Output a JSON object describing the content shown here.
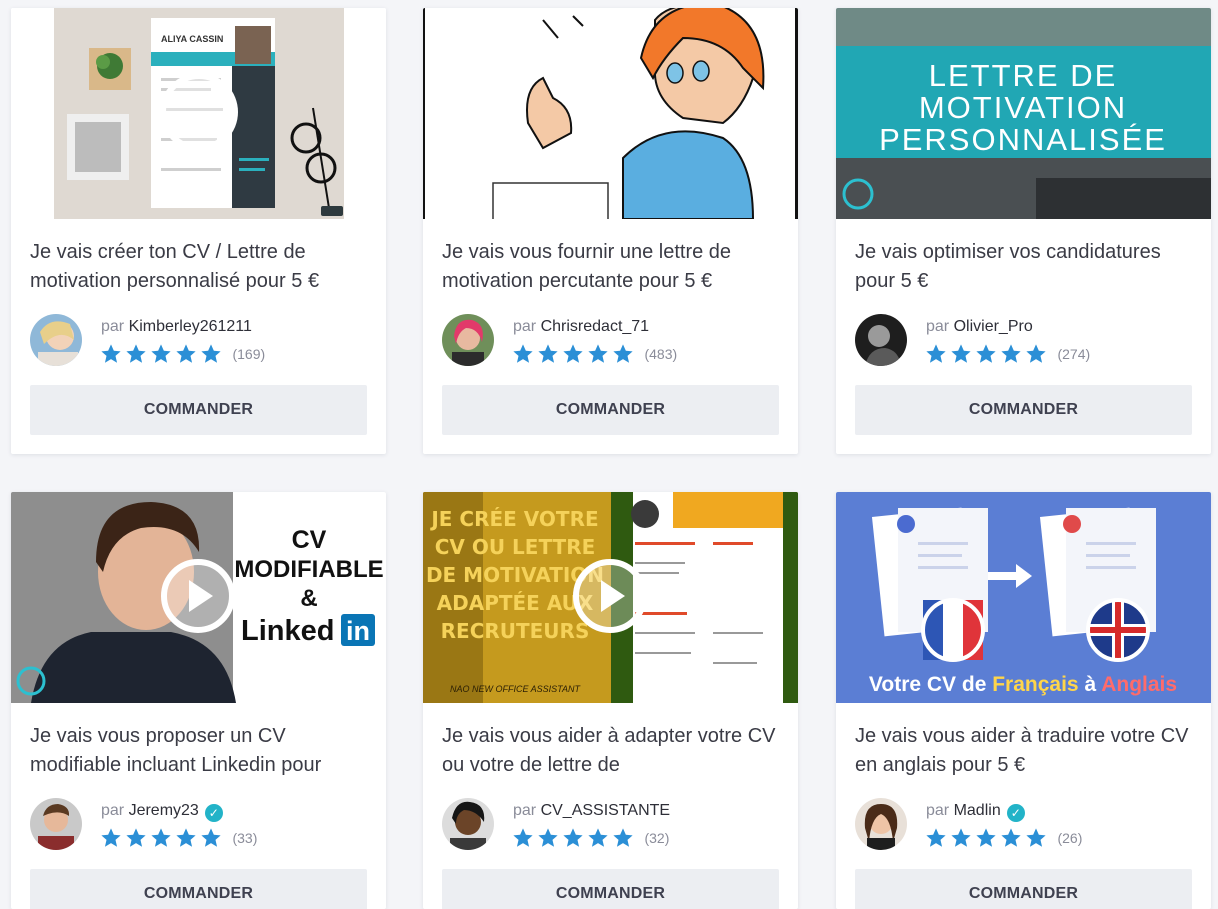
{
  "cards": [
    {
      "title": "Je vais créer ton CV / Lettre de motivation personnalisé pour 5 €",
      "by": "par",
      "seller": "Kimberley261211",
      "verified": false,
      "rating_count": "(169)",
      "order_label": "COMMANDER",
      "thumb_text": [
        "ALIYA CASSIN"
      ]
    },
    {
      "title": "Je vais vous fournir une lettre de motivation percutante pour 5 €",
      "by": "par",
      "seller": "Chrisredact_71",
      "verified": false,
      "rating_count": "(483)",
      "order_label": "COMMANDER",
      "thumb_text": []
    },
    {
      "title": "Je vais optimiser vos candidatures pour 5 €",
      "by": "par",
      "seller": "Olivier_Pro",
      "verified": false,
      "rating_count": "(274)",
      "order_label": "COMMANDER",
      "thumb_text": [
        "LETTRE DE",
        "MOTIVATION",
        "PERSONNALISÉE"
      ]
    },
    {
      "title": "Je vais vous proposer un CV modifiable incluant Linkedin pour",
      "by": "par",
      "seller": "Jeremy23",
      "verified": true,
      "rating_count": "(33)",
      "order_label": "COMMANDER",
      "thumb_text": [
        "CV",
        "MODIFIABLE",
        "&",
        "Linked",
        "in"
      ]
    },
    {
      "title": "Je vais vous aider à adapter votre CV ou votre de lettre de",
      "by": "par",
      "seller": "CV_ASSISTANTE",
      "verified": false,
      "rating_count": "(32)",
      "order_label": "COMMANDER",
      "thumb_text": [
        "JE CRÉE VOTRE",
        "CV OU LETTRE",
        "DE MOTIVATION",
        "ADAPTÉE AUX",
        "RECRUTEURS",
        "NAO NEW OFFICE ASSISTANT"
      ]
    },
    {
      "title": "Je vais vous aider à traduire votre CV en anglais pour 5 €",
      "by": "par",
      "seller": "Madlin",
      "verified": true,
      "rating_count": "(26)",
      "order_label": "COMMANDER",
      "thumb_text": [
        "Votre CV de ",
        "Français",
        " à ",
        "Anglais"
      ]
    }
  ],
  "colors": {
    "star": "#2b8fd6",
    "verified": "#22b3c8",
    "button_bg": "#eceef2"
  }
}
